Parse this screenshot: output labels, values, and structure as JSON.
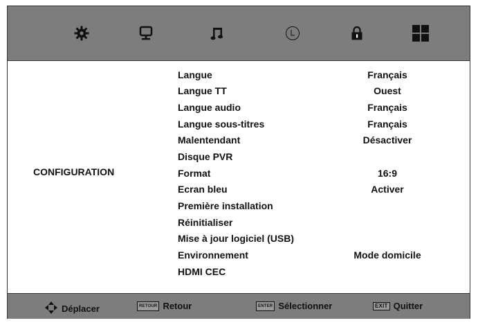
{
  "topbar": {
    "tabs": [
      {
        "icon": "picture-settings-icon"
      },
      {
        "icon": "screen-icon"
      },
      {
        "icon": "music-icon"
      },
      {
        "icon": "clock-icon"
      },
      {
        "icon": "lock-icon"
      },
      {
        "icon": "grid-icon"
      }
    ],
    "selected_tab": 0
  },
  "section": {
    "title": "CONFIGURATION"
  },
  "menu": {
    "items": [
      {
        "label": "Langue",
        "value": "Français"
      },
      {
        "label": "Langue TT",
        "value": "Ouest"
      },
      {
        "label": "Langue audio",
        "value": "Français"
      },
      {
        "label": "Langue sous-titres",
        "value": "Français"
      },
      {
        "label": "Malentendant",
        "value": "Désactiver"
      },
      {
        "label": "Disque PVR",
        "value": ""
      },
      {
        "label": "Format",
        "value": "16:9"
      },
      {
        "label": "Ecran bleu",
        "value": "Activer"
      },
      {
        "label": "Première installation",
        "value": ""
      },
      {
        "label": "Réinitialiser",
        "value": ""
      },
      {
        "label": "Mise à jour logiciel (USB)",
        "value": ""
      },
      {
        "label": "Environnement",
        "value": "Mode domicile"
      },
      {
        "label": "HDMI CEC",
        "value": ""
      }
    ]
  },
  "footer": {
    "move": {
      "label": "Déplacer",
      "icon": "dpad-arrows-icon"
    },
    "back": {
      "key": "RETOUR",
      "label": "Retour"
    },
    "select": {
      "key": "ENTER",
      "label": "Sélectionner"
    },
    "exit": {
      "key": "EXIT",
      "label": "Quitter"
    }
  },
  "colors": {
    "bar_background": "#7d7d7d",
    "content_background": "#ffffff",
    "text": "#111111"
  }
}
